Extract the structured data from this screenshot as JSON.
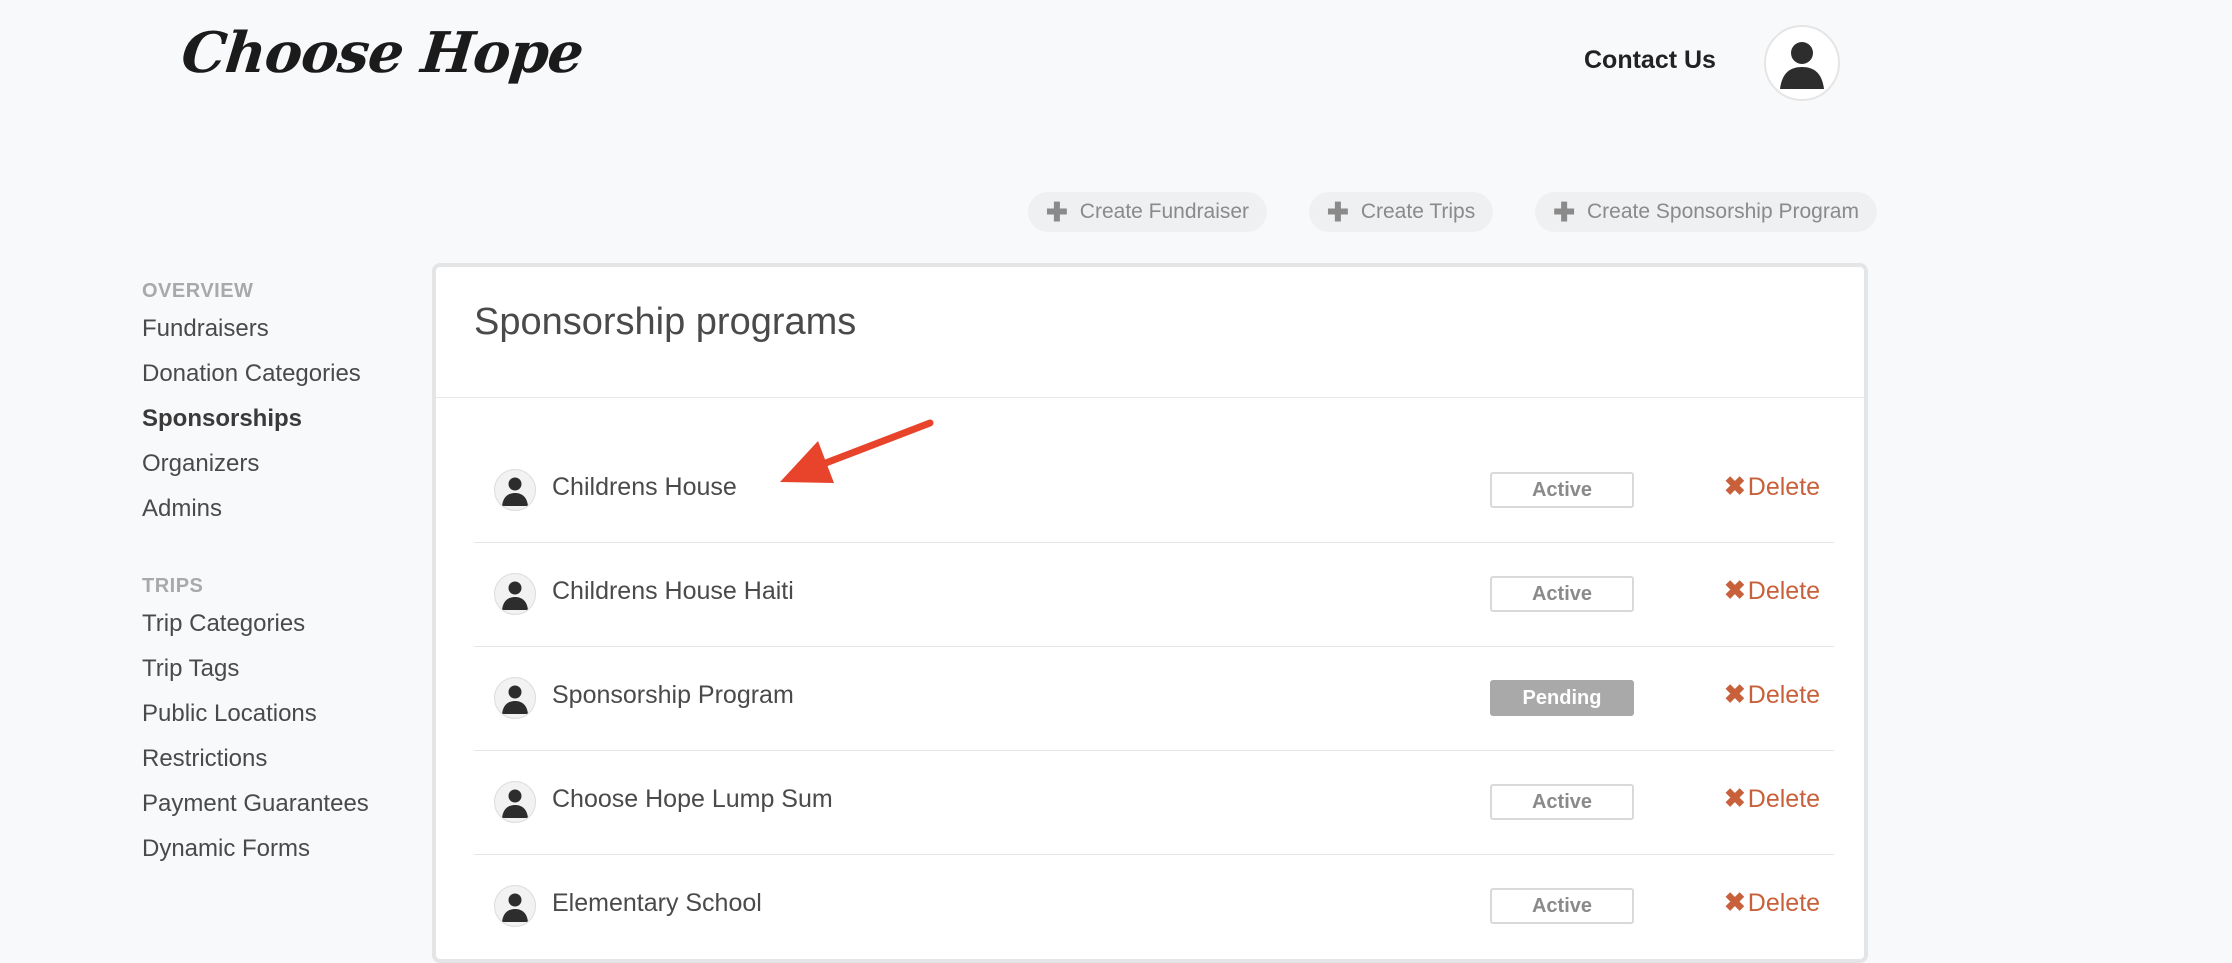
{
  "header": {
    "logo_text": "Choose Hope",
    "contact_label": "Contact Us"
  },
  "actions": [
    {
      "label": "Create Fundraiser"
    },
    {
      "label": "Create Trips"
    },
    {
      "label": "Create Sponsorship Program"
    }
  ],
  "sidebar": {
    "overview_heading": "OVERVIEW",
    "overview_items": [
      {
        "label": "Fundraisers"
      },
      {
        "label": "Donation Categories"
      },
      {
        "label": "Sponsorships"
      },
      {
        "label": "Organizers"
      },
      {
        "label": "Admins"
      }
    ],
    "active_item": "Sponsorships",
    "trips_heading": "TRIPS",
    "trips_items": [
      {
        "label": "Trip Categories"
      },
      {
        "label": "Trip Tags"
      },
      {
        "label": "Public Locations"
      },
      {
        "label": "Restrictions"
      },
      {
        "label": "Payment Guarantees"
      },
      {
        "label": "Dynamic Forms"
      }
    ]
  },
  "main": {
    "title": "Sponsorship programs",
    "delete_label": "Delete",
    "programs": [
      {
        "name": "Childrens House",
        "status": "Active"
      },
      {
        "name": "Childrens House Haiti",
        "status": "Active"
      },
      {
        "name": "Sponsorship Program",
        "status": "Pending"
      },
      {
        "name": "Choose Hope Lump Sum",
        "status": "Active"
      },
      {
        "name": "Elementary School",
        "status": "Active"
      }
    ]
  },
  "annotation": {
    "arrow_color": "#e8442c"
  },
  "colors": {
    "delete": "#c8613b",
    "pending_badge": "#a9a9a9",
    "background": "#f8f9fb"
  },
  "icons": {
    "user": "person-silhouette-icon",
    "plus": "plus-icon",
    "delete": "x-icon"
  }
}
